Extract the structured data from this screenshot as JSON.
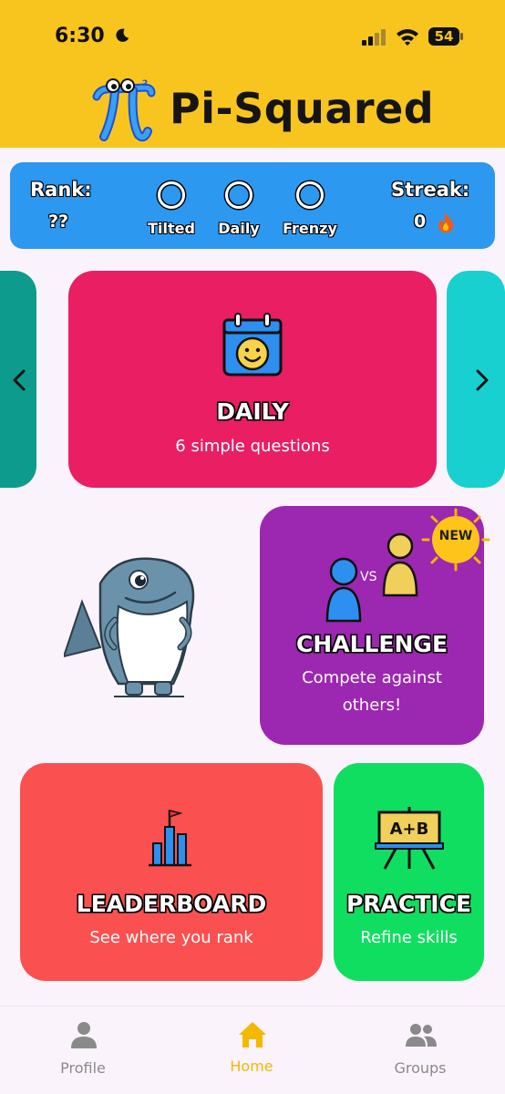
{
  "status": {
    "time": "6:30",
    "battery": "54"
  },
  "header": {
    "title": "Pi-Squared"
  },
  "stats": {
    "rank_label": "Rank:",
    "rank_value": "??",
    "modes": [
      "Tilted",
      "Daily",
      "Frenzy"
    ],
    "streak_label": "Streak:",
    "streak_value": "0",
    "streak_icon": "🔥"
  },
  "cards": {
    "daily": {
      "title": "DAILY",
      "subtitle": "6 simple questions"
    },
    "challenge": {
      "title": "CHALLENGE",
      "subtitle_line1": "Compete against",
      "subtitle_line2": "others!",
      "badge": "NEW",
      "vs": "VS"
    },
    "leaderboard": {
      "title": "LEADERBOARD",
      "subtitle": "See where you rank"
    },
    "practice": {
      "title": "PRACTICE",
      "subtitle": "Refine skills",
      "board_text": "A+B"
    }
  },
  "nav": {
    "tabs": [
      {
        "label": "Profile",
        "icon": "person-icon",
        "active": false
      },
      {
        "label": "Home",
        "icon": "home-icon",
        "active": true
      },
      {
        "label": "Groups",
        "icon": "groups-icon",
        "active": false
      }
    ]
  },
  "colors": {
    "header": "#f8c51f",
    "stats": "#2d98ef",
    "daily": "#e91e63",
    "challenge": "#9c27b0",
    "leaderboard": "#fb5050",
    "practice": "#10de60",
    "active_tab": "#f3b800"
  }
}
